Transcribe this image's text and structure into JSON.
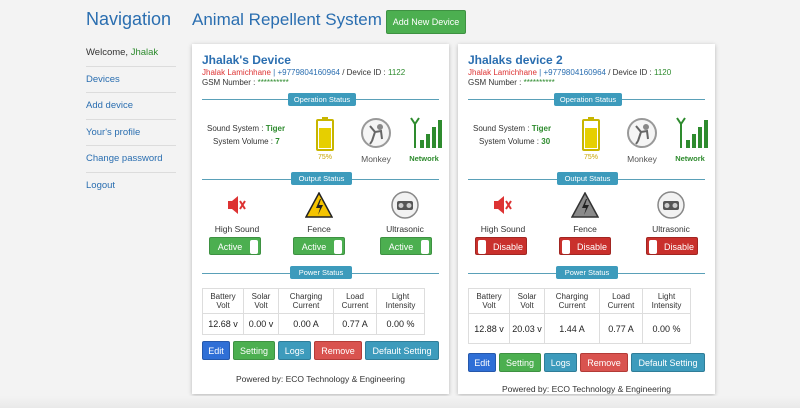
{
  "nav": {
    "title": "Navigation",
    "welcome_prefix": "Welcome, ",
    "welcome_user": "Jhalak",
    "items": [
      {
        "label": "Devices"
      },
      {
        "label": "Add device"
      },
      {
        "label": "Your's profile"
      },
      {
        "label": "Change password"
      },
      {
        "label": "Logout"
      }
    ]
  },
  "header": {
    "title": "Animal Repellent System",
    "add_button": "Add New Device"
  },
  "colors": {
    "primary": "#2a6eb0",
    "success": "#4caf50",
    "danger": "#c9302c",
    "info": "#3d9bbc"
  },
  "section_labels": {
    "operation": "Operation Status",
    "output": "Output Status",
    "power": "Power Status"
  },
  "labels": {
    "sound_system": "Sound System : ",
    "system_volume": "System Volume : ",
    "device_id": " / Device ID : ",
    "gsm": "GSM Number : ",
    "monkey": "Monkey",
    "network": "Network",
    "high_sound": "High Sound",
    "fence": "Fence",
    "ultrasonic": "Ultrasonic",
    "power_headers": [
      "Battery Volt",
      "Solar Volt",
      "Charging Current",
      "Load Current",
      "Light Intensity"
    ],
    "edit": "Edit",
    "setting": "Setting",
    "logs": "Logs",
    "remove": "Remove",
    "default_setting": "Default Setting",
    "powered_by": "Powered by: ECO Technology & Engineering"
  },
  "devices": [
    {
      "title": "Jhalak's Device",
      "owner": "Jhalak Lamichhane",
      "phone": " | +9779804160964",
      "device_id": "1122",
      "gsm": "**********",
      "sound_system": "Tiger",
      "system_volume": "7",
      "battery_level": 75,
      "battery_label": "75%",
      "high_sound": "Active",
      "fence": "Active",
      "ultrasonic": "Active",
      "power_values": [
        "12.68 v",
        "0.00 v",
        "0.00 A",
        "0.77 A",
        "0.00 %"
      ]
    },
    {
      "title": "Jhalaks device 2",
      "owner": "Jhalak Lamichhane",
      "phone": " | +9779804160964",
      "device_id": "1120",
      "gsm": "**********",
      "sound_system": "Tiger",
      "system_volume": "30",
      "battery_level": 75,
      "battery_label": "75%",
      "high_sound": "Disable",
      "fence": "Disable",
      "ultrasonic": "Disable",
      "power_values": [
        "12.88 v",
        "20.03 v",
        "1.44 A",
        "0.77 A",
        "0.00 %"
      ]
    }
  ]
}
